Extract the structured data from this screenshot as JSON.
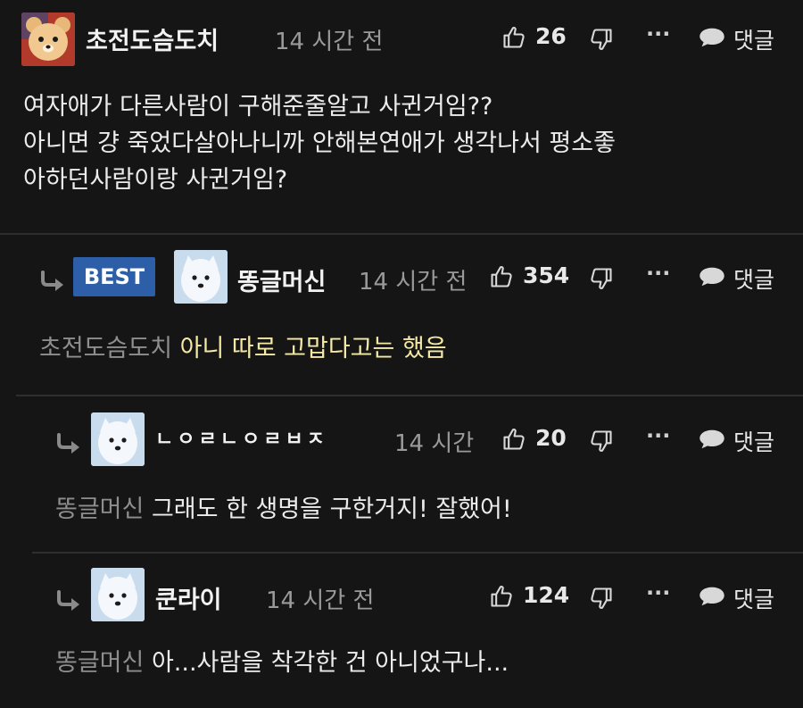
{
  "comments": [
    {
      "nick": "초전도슴도치",
      "time": "14 시간 전",
      "likes": "26",
      "reply_label": "댓글",
      "lines": [
        "여자애가 다른사람이 구해준줄알고 사귄거임??",
        "아니면 걍 죽었다살아나니까 안해본연애가 생각나서 평소좋",
        "아하던사람이랑 사귄거임?"
      ]
    },
    {
      "badge": "BEST",
      "nick": "똥글머신",
      "time": "14 시간 전",
      "likes": "354",
      "reply_label": "댓글",
      "mention": "초전도슴도치",
      "text": "아니 따로 고맙다고는 했음"
    },
    {
      "nick": "ㄴㅇㄹㄴㅇㄹㅂㅈ",
      "time": "14 시간",
      "likes": "20",
      "reply_label": "댓글",
      "mention": "똥글머신",
      "text": "그래도 한 생명을 구한거지! 잘했어!"
    },
    {
      "nick": "쿤라이",
      "time": "14 시간 전",
      "likes": "124",
      "reply_label": "댓글",
      "mention": "똥글머신",
      "text": "아...사람을 착각한 건 아니었구나..."
    }
  ],
  "icons": [
    "thumbs-up-icon",
    "thumbs-down-icon",
    "more-icon",
    "speech-bubble-icon",
    "reply-arrow-icon"
  ],
  "colors": {
    "background": "#151515",
    "best_badge": "#2d5ea8",
    "highlight_text": "#f5e9a6",
    "muted": "#8e8e8e"
  }
}
